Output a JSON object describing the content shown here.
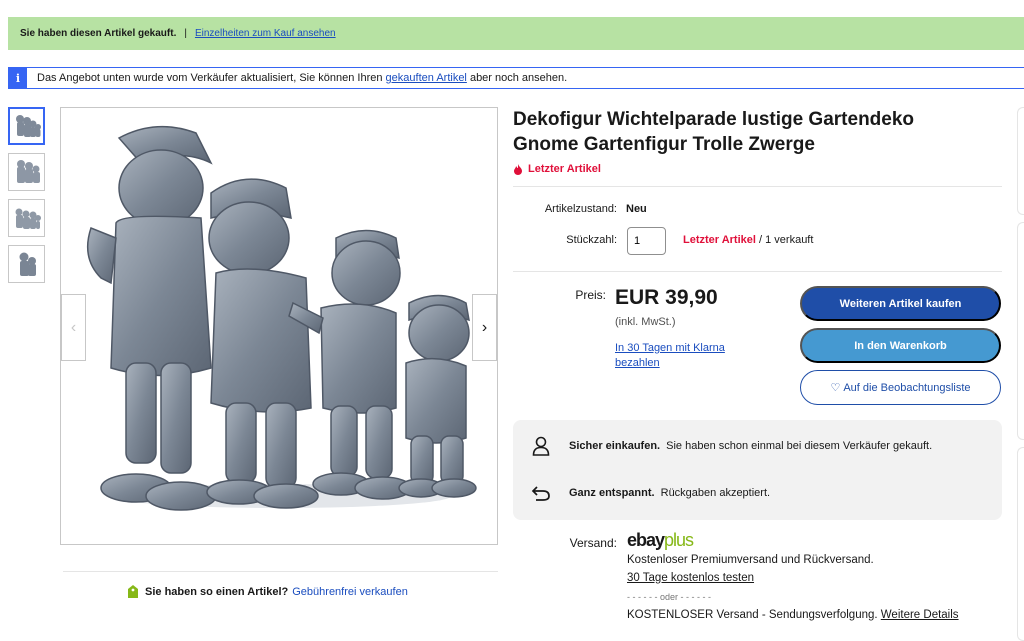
{
  "purchase_notice": {
    "text": "Sie haben diesen Artikel gekauft.",
    "separator": "|",
    "link": "Einzelheiten zum Kauf ansehen"
  },
  "info_notice": {
    "icon": "i",
    "text_before": "Das Angebot unten wurde vom Verkäufer aktualisiert, Sie können Ihren ",
    "link": "gekauften Artikel",
    "text_after": " aber noch ansehen."
  },
  "gallery": {
    "thumbnail_count": 4,
    "prev_arrow": "‹",
    "next_arrow": "›"
  },
  "sell_prompt": {
    "question": "Sie haben so einen Artikel?",
    "link": "Gebührenfrei verkaufen"
  },
  "product": {
    "title": "Dekofigur Wichtelparade lustige Gartendeko Gnome Gartenfigur Trolle Zwerge",
    "urgency": "Letzter Artikel",
    "condition_label": "Artikelzustand:",
    "condition_value": "Neu",
    "quantity_label": "Stückzahl:",
    "quantity_value": "1",
    "quantity_status_red": "Letzter Artikel",
    "quantity_status_rest": " / 1 verkauft",
    "price_label": "Preis:",
    "price": "EUR 39,90",
    "vat_note": "(inkl. MwSt.)",
    "klarna_link": "In 30 Tagen mit Klarna bezahlen"
  },
  "actions": {
    "buy_label": "Weiteren Artikel kaufen",
    "cart_label": "In den Warenkorb",
    "watch_label": "Auf die Beobachtungsliste",
    "watch_icon": "♡"
  },
  "trust": {
    "secure_bold": "Sicher einkaufen.",
    "secure_text": " Sie haben schon einmal bei diesem Verkäufer gekauft.",
    "returns_bold": "Ganz entspannt.",
    "returns_text": " Rückgaben akzeptiert."
  },
  "shipping": {
    "label": "Versand:",
    "brand_ebay": "ebay",
    "brand_plus": "plus",
    "premium_line": "Kostenloser Premiumversand und Rückversand.",
    "trial_link": "30 Tage kostenlos testen",
    "oder": "- - - - - - oder - - - - - -",
    "free_line": "KOSTENLOSER Versand - Sendungsverfolgung. ",
    "details_link": "Weitere Details"
  },
  "colors": {
    "accent_blue": "#3665f3",
    "buy_button": "#1f4ea8",
    "cart_button": "#4599d1",
    "alert_red": "#e0103a",
    "purchase_green": "#b7e2a3",
    "plus_green": "#86b817"
  }
}
